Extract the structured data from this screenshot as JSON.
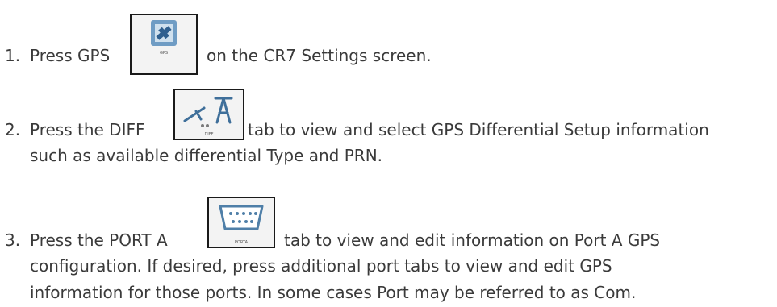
{
  "steps": [
    {
      "num": "1.",
      "pre": "Press GPS",
      "post": "on the CR7 Settings screen.",
      "icon": "gps-satellite-icon",
      "icon_caption": "GPS"
    },
    {
      "num": "2.",
      "pre": "Press the DIFF",
      "post": "tab to view and select GPS Differential Setup information",
      "line2": "such as available differential Type and PRN.",
      "icon": "differential-antenna-icon",
      "icon_caption": "DIFF"
    },
    {
      "num": "3.",
      "pre": "Press the PORT A",
      "post": "tab to view and edit information on Port A GPS",
      "line2": "configuration. If desired, press additional port tabs to view and edit GPS",
      "line3": "information for those ports. In some cases Port may be referred to as Com.",
      "icon": "serial-port-icon",
      "icon_caption": "PORTA"
    }
  ]
}
